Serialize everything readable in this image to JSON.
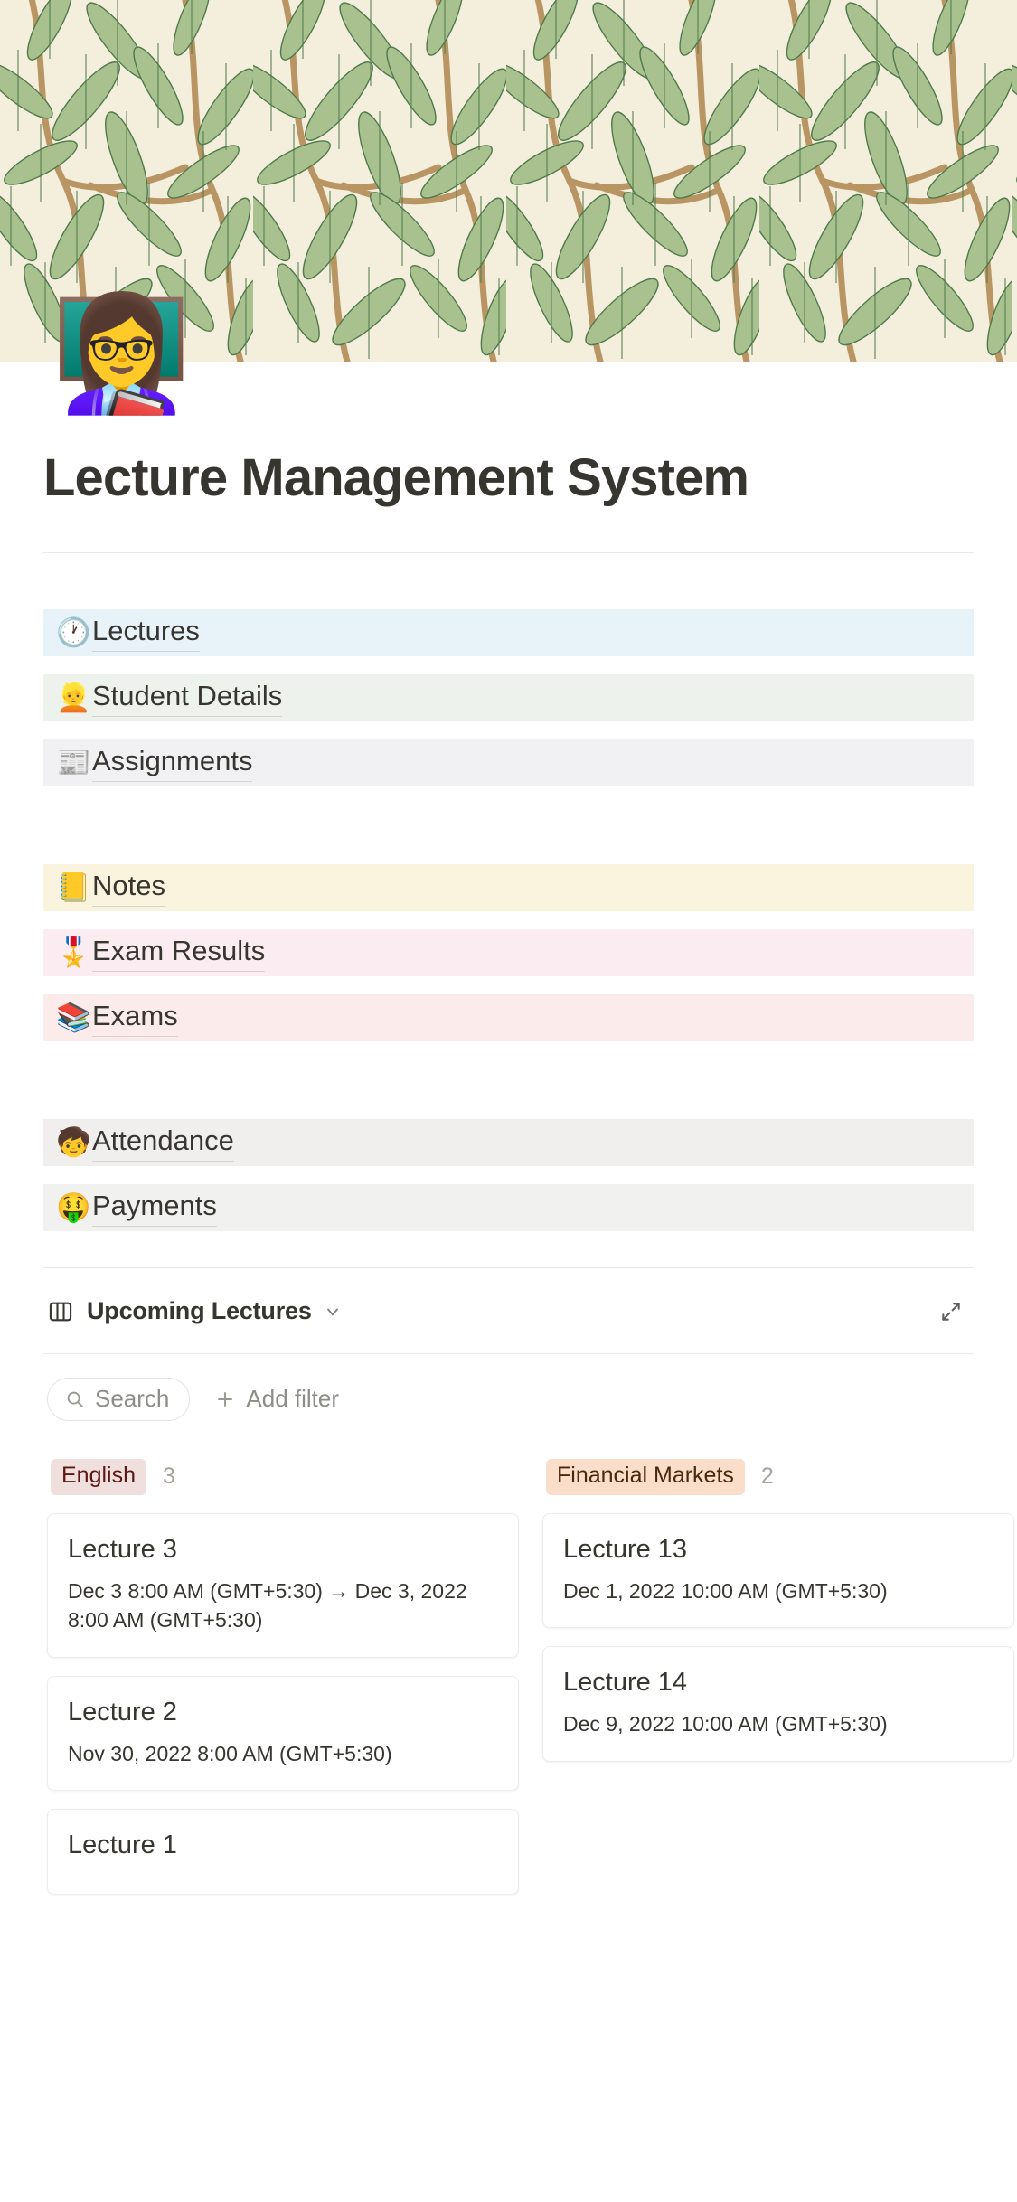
{
  "cover": {
    "name": "willow-bough-pattern",
    "bg": "#f4eedd",
    "leaf_light": "#a8bf8e",
    "leaf_dark": "#4f7a4a",
    "stem": "#b99563"
  },
  "page": {
    "icon": "👩‍🏫",
    "icon_name": "woman-teacher-emoji",
    "title": "Lecture Management System"
  },
  "nav_links": [
    {
      "emoji": "🕐",
      "icon_name": "clock-emoji",
      "label": "Lectures",
      "bg": "#e7f3f8"
    },
    {
      "emoji": "👱",
      "icon_name": "blond-person-emoji",
      "label": "Student Details",
      "bg": "#edf3ec"
    },
    {
      "emoji": "📰",
      "icon_name": "newspaper-emoji",
      "label": "Assignments",
      "bg": "#f1f1f4"
    },
    {
      "emoji": "📒",
      "icon_name": "ledger-emoji",
      "label": "Notes",
      "bg": "#faf3dd"
    },
    {
      "emoji": "🎖️",
      "icon_name": "medal-emoji",
      "label": "Exam Results",
      "bg": "#fbecf2"
    },
    {
      "emoji": "📚",
      "icon_name": "books-emoji",
      "label": "Exams",
      "bg": "#fbeceb"
    },
    {
      "emoji": "🧒",
      "icon_name": "child-emoji",
      "label": "Attendance",
      "bg": "#f1eeee"
    },
    {
      "emoji": "🤑",
      "icon_name": "money-mouth-emoji",
      "label": "Payments",
      "bg": "#f1f1f0"
    }
  ],
  "database": {
    "view_name": "Upcoming Lectures",
    "view_icon": "board-view-icon",
    "search_label": "Search",
    "add_filter_label": "Add filter",
    "columns": [
      {
        "name": "English",
        "count": "3",
        "badge_bg": "#f0e0dd",
        "badge_color": "#5d1715",
        "cards": [
          {
            "title": "Lecture 3",
            "date": "Dec 3 8:00 AM (GMT+5:30) → Dec 3, 2022 8:00 AM (GMT+5:30)"
          },
          {
            "title": "Lecture 2",
            "date": "Nov 30, 2022 8:00 AM (GMT+5:30)"
          },
          {
            "title": "Lecture 1",
            "date": ""
          }
        ]
      },
      {
        "name": "Financial Markets",
        "count": "2",
        "badge_bg": "#fadec9",
        "badge_color": "#49290e",
        "cards": [
          {
            "title": "Lecture 13",
            "date": "Dec 1, 2022 10:00 AM (GMT+5:30)"
          },
          {
            "title": "Lecture 14",
            "date": "Dec 9, 2022 10:00 AM (GMT+5:30)"
          }
        ]
      }
    ]
  }
}
